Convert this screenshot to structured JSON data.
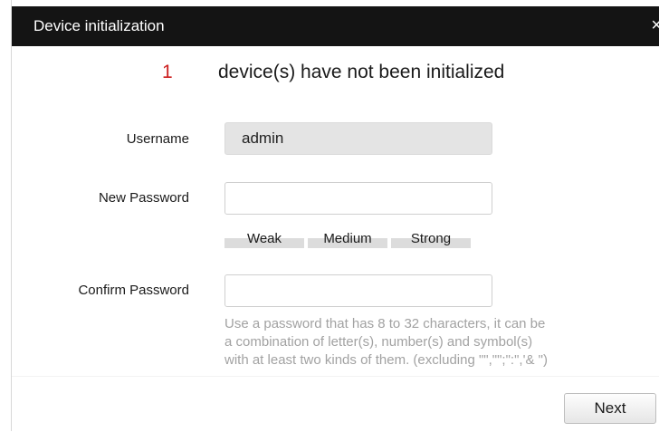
{
  "dialog": {
    "title": "Device initialization",
    "close_label": "×"
  },
  "status": {
    "count": "1",
    "message": "device(s) have not been initialized"
  },
  "form": {
    "username_label": "Username",
    "username_value": "admin",
    "new_password_label": "New Password",
    "new_password_value": "",
    "confirm_password_label": "Confirm Password",
    "confirm_password_value": ""
  },
  "strength": {
    "levels": [
      "Weak",
      "Medium",
      "Strong"
    ]
  },
  "hint": {
    "lines": [
      "Use a password that has 8 to 32 characters, it can be",
      "a combination of letter(s), number(s) and symbol(s)",
      "with at least two kinds of them. (excluding \"\",\"\";\":\",'& \")"
    ]
  },
  "buttons": {
    "next_label": "Next"
  }
}
